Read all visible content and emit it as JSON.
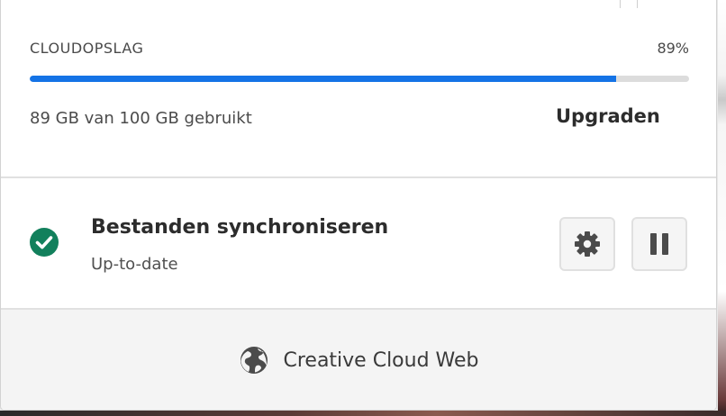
{
  "storage": {
    "title": "CLOUDOPSLAG",
    "percent_label": "89%",
    "used_fraction": 0.89,
    "usage_text": "89 GB van 100 GB gebruikt",
    "upgrade_label": "Upgraden"
  },
  "sync": {
    "title": "Bestanden synchroniseren",
    "status": "Up-to-date",
    "status_icon": "check-circle-icon",
    "settings_icon": "gear-icon",
    "pause_icon": "pause-icon"
  },
  "footer": {
    "label": "Creative Cloud Web",
    "icon": "globe-icon"
  },
  "colors": {
    "accent": "#1473e6",
    "success": "#12805c"
  }
}
